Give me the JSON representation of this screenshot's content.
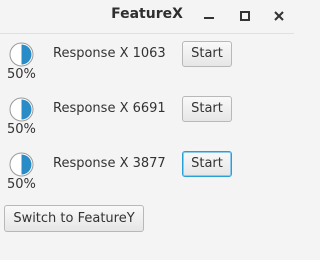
{
  "window": {
    "title": "FeatureX",
    "controls": {
      "minimize_icon": "minimize-icon",
      "maximize_icon": "maximize-icon",
      "close_icon": "close-icon"
    }
  },
  "rows": [
    {
      "label": "Response X 1063",
      "progress_text": "50%",
      "progress": 0.5,
      "button_label": "Start",
      "focused": false
    },
    {
      "label": "Response X 6691",
      "progress_text": "50%",
      "progress": 0.5,
      "button_label": "Start",
      "focused": false
    },
    {
      "label": "Response X 3877",
      "progress_text": "50%",
      "progress": 0.5,
      "button_label": "Start",
      "focused": true
    }
  ],
  "footer": {
    "switch_label": "Switch to FeatureY"
  },
  "colors": {
    "accent": "#2a9fd6",
    "indicator_fill": "#2a8cc7",
    "background": "#f4f4f4"
  }
}
